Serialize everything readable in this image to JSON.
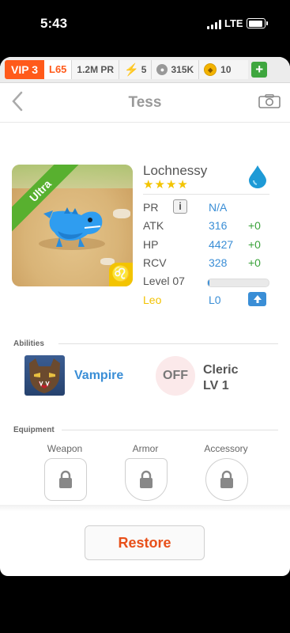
{
  "status_bar": {
    "time": "5:43",
    "network": "LTE"
  },
  "top_bar": {
    "vip": "VIP 3",
    "level": "L65",
    "power_rating": "1.2M PR",
    "energy": "5",
    "paw_currency": "315K",
    "coins": "10",
    "add_icon": "plus-icon"
  },
  "nav": {
    "title": "Tess",
    "back_icon": "chevron-left-icon",
    "camera_icon": "camera-icon"
  },
  "monster": {
    "name": "Lochnessy",
    "rarity": "Ultra",
    "stars": "★★★★",
    "element_icon": "water-drop-icon",
    "sign_glyph": "♌",
    "stats": [
      {
        "label": "PR",
        "value": "N/A",
        "bonus": ""
      },
      {
        "label": "ATK",
        "value": "316",
        "bonus": "+0"
      },
      {
        "label": "HP",
        "value": "4427",
        "bonus": "+0"
      },
      {
        "label": "RCV",
        "value": "328",
        "bonus": "+0"
      }
    ],
    "level_label": "Level 07",
    "xp_progress": 0.02,
    "sign_label": "Leo",
    "sign_level": "L0"
  },
  "abilities": {
    "label": "Abilities",
    "primary": {
      "name": "Vampire"
    },
    "secondary": {
      "status": "OFF",
      "name": "Cleric",
      "level": "LV 1"
    }
  },
  "equipment": {
    "label": "Equipment",
    "slots": [
      {
        "label": "Weapon"
      },
      {
        "label": "Armor"
      },
      {
        "label": "Accessory"
      }
    ]
  },
  "actions": {
    "restore": "Restore"
  },
  "colors": {
    "accent": "#3a8ed6",
    "vip": "#ff5a1a",
    "bonus": "#3aa23a",
    "restore": "#e8501a",
    "ribbon": "#58b02f"
  }
}
